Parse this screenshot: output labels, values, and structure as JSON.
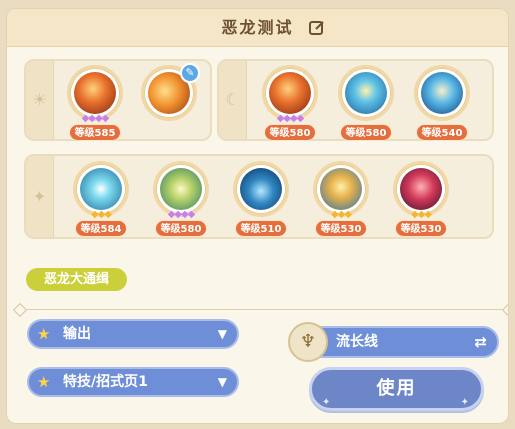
{
  "title": "恶龙测试",
  "icons": {
    "edit": "edit-icon",
    "sun": "sun-icon",
    "moon": "moon-icon",
    "star": "star-icon"
  },
  "group_sun": {
    "cards": [
      {
        "level": "等级585",
        "gems": "◆◆◆◆",
        "gem_color": "purple",
        "art": "fire"
      },
      {
        "level": "",
        "gems": "",
        "gem_color": "",
        "art": "fire2",
        "badge": "feather-badge-icon"
      }
    ]
  },
  "group_moon": {
    "cards": [
      {
        "level": "等级580",
        "gems": "◆◆◆◆",
        "gem_color": "purple",
        "art": "fire"
      },
      {
        "level": "等级580",
        "gems": "",
        "gem_color": "",
        "art": "blue"
      },
      {
        "level": "等级540",
        "gems": "",
        "gem_color": "",
        "art": "blue2"
      }
    ]
  },
  "group_star": {
    "cards": [
      {
        "level": "等级584",
        "gems": "◆◆◆",
        "gem_color": "yellow",
        "art": "teal"
      },
      {
        "level": "等级580",
        "gems": "◆◆◆◆",
        "gem_color": "purple",
        "art": "green"
      },
      {
        "level": "等级510",
        "gems": "",
        "gem_color": "",
        "art": "darkblue"
      },
      {
        "level": "等级530",
        "gems": "◆◆◆",
        "gem_color": "yellow",
        "art": "gold"
      },
      {
        "level": "等级530",
        "gems": "◆◆◆",
        "gem_color": "yellow",
        "art": "red"
      }
    ]
  },
  "tag": "恶龙大通缉",
  "selects": {
    "role": "输出",
    "page": "特技/招式页1"
  },
  "route": {
    "label": "流长线"
  },
  "use_button": "使用",
  "colors": {
    "accent": "#6e8ed8",
    "level_badge": "#e46e3d",
    "tag": "#cbd03a"
  }
}
